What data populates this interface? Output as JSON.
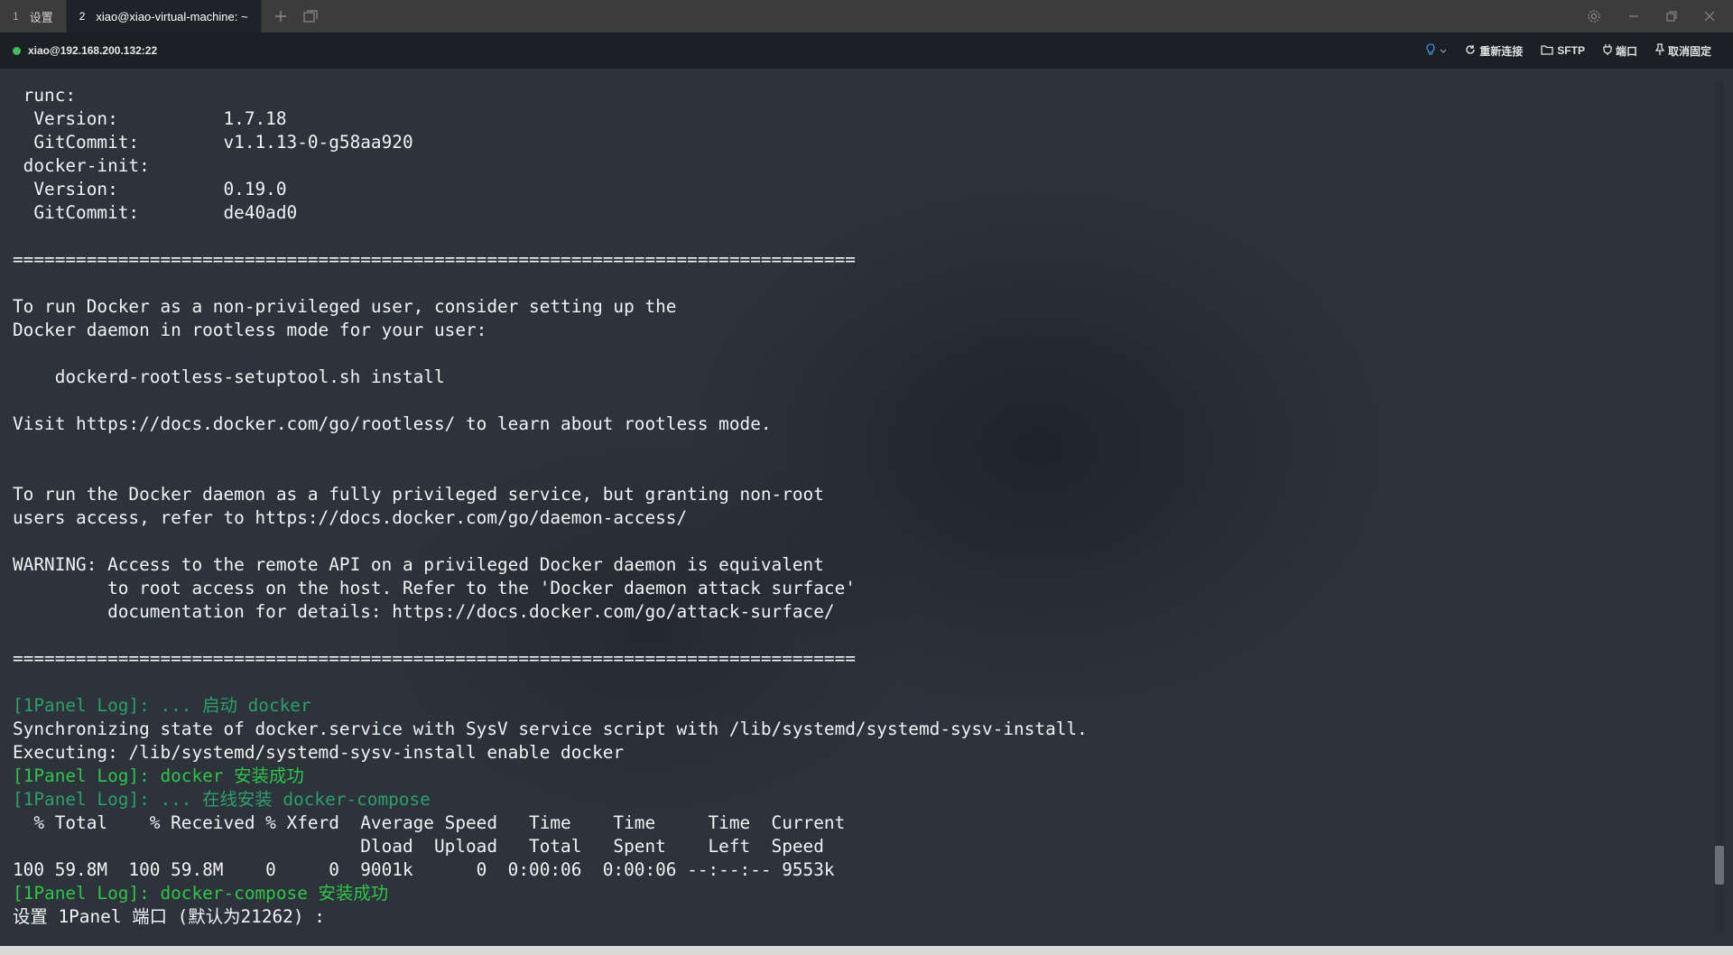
{
  "tabs": [
    {
      "number": "1",
      "label": "设置"
    },
    {
      "number": "2",
      "label": "xiao@xiao-virtual-machine: ~"
    }
  ],
  "tab_actions": {
    "add_icon": "plus-icon",
    "windows_icon": "windows-icon"
  },
  "window_controls": [
    "settings-icon",
    "minimize-icon",
    "restore-icon",
    "close-icon"
  ],
  "session": {
    "host": "xiao@192.168.200.132:22",
    "status_color": "#3fbf5a",
    "actions": {
      "reconnect": "重新连接",
      "sftp": "SFTP",
      "port": "端口",
      "unpin": "取消固定"
    }
  },
  "terminal": {
    "lines": [
      {
        "text": " runc:",
        "style": "normal"
      },
      {
        "text": "  Version:          1.7.18",
        "style": "normal"
      },
      {
        "text": "  GitCommit:        v1.1.13-0-g58aa920",
        "style": "normal"
      },
      {
        "text": " docker-init:",
        "style": "normal"
      },
      {
        "text": "  Version:          0.19.0",
        "style": "normal"
      },
      {
        "text": "  GitCommit:        de40ad0",
        "style": "normal"
      },
      {
        "text": "",
        "style": "normal"
      },
      {
        "text": "================================================================================",
        "style": "normal"
      },
      {
        "text": "",
        "style": "normal"
      },
      {
        "text": "To run Docker as a non-privileged user, consider setting up the",
        "style": "normal"
      },
      {
        "text": "Docker daemon in rootless mode for your user:",
        "style": "normal"
      },
      {
        "text": "",
        "style": "normal"
      },
      {
        "text": "    dockerd-rootless-setuptool.sh install",
        "style": "normal"
      },
      {
        "text": "",
        "style": "normal"
      },
      {
        "text": "Visit https://docs.docker.com/go/rootless/ to learn about rootless mode.",
        "style": "normal"
      },
      {
        "text": "",
        "style": "normal"
      },
      {
        "text": "",
        "style": "normal"
      },
      {
        "text": "To run the Docker daemon as a fully privileged service, but granting non-root",
        "style": "normal"
      },
      {
        "text": "users access, refer to https://docs.docker.com/go/daemon-access/",
        "style": "normal"
      },
      {
        "text": "",
        "style": "normal"
      },
      {
        "text": "WARNING: Access to the remote API on a privileged Docker daemon is equivalent",
        "style": "normal"
      },
      {
        "text": "         to root access on the host. Refer to the 'Docker daemon attack surface'",
        "style": "normal"
      },
      {
        "text": "         documentation for details: https://docs.docker.com/go/attack-surface/",
        "style": "normal"
      },
      {
        "text": "",
        "style": "normal"
      },
      {
        "text": "================================================================================",
        "style": "normal"
      },
      {
        "text": "",
        "style": "normal"
      },
      {
        "text": "[1Panel Log]: ... 启动 docker",
        "style": "log"
      },
      {
        "text": "Synchronizing state of docker.service with SysV service script with /lib/systemd/systemd-sysv-install.",
        "style": "normal"
      },
      {
        "text": "Executing: /lib/systemd/systemd-sysv-install enable docker",
        "style": "normal"
      },
      {
        "text": "[1Panel Log]: docker 安装成功",
        "style": "ok"
      },
      {
        "text": "[1Panel Log]: ... 在线安装 docker-compose",
        "style": "log"
      },
      {
        "text": "  % Total    % Received % Xferd  Average Speed   Time    Time     Time  Current",
        "style": "normal"
      },
      {
        "text": "                                 Dload  Upload   Total   Spent    Left  Speed",
        "style": "normal"
      },
      {
        "text": "100 59.8M  100 59.8M    0     0  9001k      0  0:00:06  0:00:06 --:--:-- 9553k",
        "style": "normal"
      },
      {
        "text": "[1Panel Log]: docker-compose 安装成功",
        "style": "ok"
      },
      {
        "text": "设置 1Panel 端口 (默认为21262) :",
        "style": "normal"
      }
    ],
    "scroll_position": 0.94,
    "scroll_visible_fraction": 0.045,
    "colors": {
      "log": "#2e9e6a",
      "success": "#2fc44a",
      "text": "#f2f2f2"
    }
  }
}
